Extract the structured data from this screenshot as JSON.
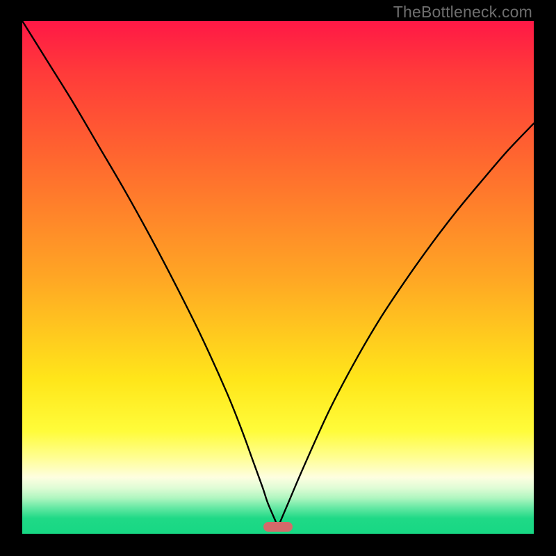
{
  "watermark": "TheBottleneck.com",
  "colors": {
    "marker": "#d46a6a",
    "curve": "#000000"
  },
  "chart_data": {
    "type": "line",
    "title": "",
    "xlabel": "",
    "ylabel": "",
    "xlim": [
      0,
      100
    ],
    "ylim": [
      0,
      100
    ],
    "legend": false,
    "grid": false,
    "series": [
      {
        "name": "bottleneck-curve",
        "x": [
          0,
          5,
          10,
          15,
          20,
          25,
          30,
          35,
          40,
          43,
          45,
          47,
          48,
          49.5,
          50,
          50.5,
          52,
          55,
          60,
          65,
          70,
          75,
          80,
          85,
          90,
          95,
          100
        ],
        "values": [
          100,
          92,
          84,
          75.5,
          67,
          58,
          48.5,
          38.5,
          27.5,
          20,
          14.5,
          9,
          6,
          2.5,
          1.3,
          2.5,
          6,
          13,
          24,
          33.5,
          42,
          49.5,
          56.5,
          63,
          69,
          74.8,
          80
        ]
      }
    ],
    "annotations": [
      {
        "name": "sweet-spot",
        "x": 50,
        "y": 1.3
      }
    ]
  }
}
